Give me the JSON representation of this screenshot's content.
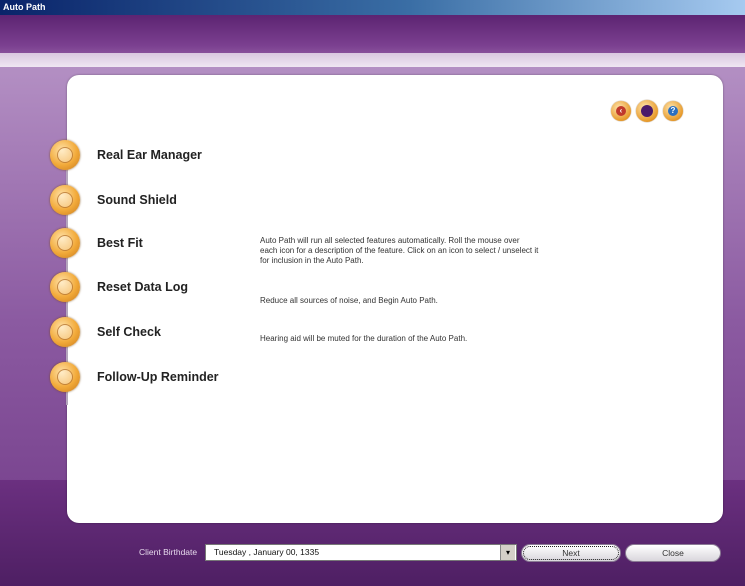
{
  "window": {
    "title": "Auto Path"
  },
  "top_icons": [
    {
      "name": "back-icon",
      "glyph": "‹"
    },
    {
      "name": "record-icon",
      "glyph": ""
    },
    {
      "name": "help-icon",
      "glyph": "?"
    }
  ],
  "features": [
    {
      "id": "real-ear-manager",
      "label": "Real Ear Manager",
      "icon": "ear-icon"
    },
    {
      "id": "sound-shield",
      "label": "Sound Shield",
      "icon": "shield-icon"
    },
    {
      "id": "best-fit",
      "label": "Best Fit",
      "icon": "target-icon"
    },
    {
      "id": "reset-data-log",
      "label": "Reset Data Log",
      "icon": "reset-icon"
    },
    {
      "id": "self-check",
      "label": "Self Check",
      "icon": "check-icon"
    },
    {
      "id": "follow-up-reminder",
      "label": "Follow-Up Reminder",
      "icon": "bell-icon"
    }
  ],
  "descriptions": {
    "intro_1": "Auto Path will run all selected features automatically.  Roll the mouse over",
    "intro_2": "each icon for a description of the feature. Click on an icon to select / unselect it",
    "intro_3": "for inclusion in the Auto Path.",
    "noise": "Reduce all sources of noise, and Begin Auto Path.",
    "muted": "Hearing aid will be muted for the duration of the Auto Path."
  },
  "footer": {
    "birthdate_label": "Client Birthdate",
    "birthdate_value": "Tuesday  ,  January  00, 1335",
    "next_label": "Next",
    "close_label": "Close"
  }
}
